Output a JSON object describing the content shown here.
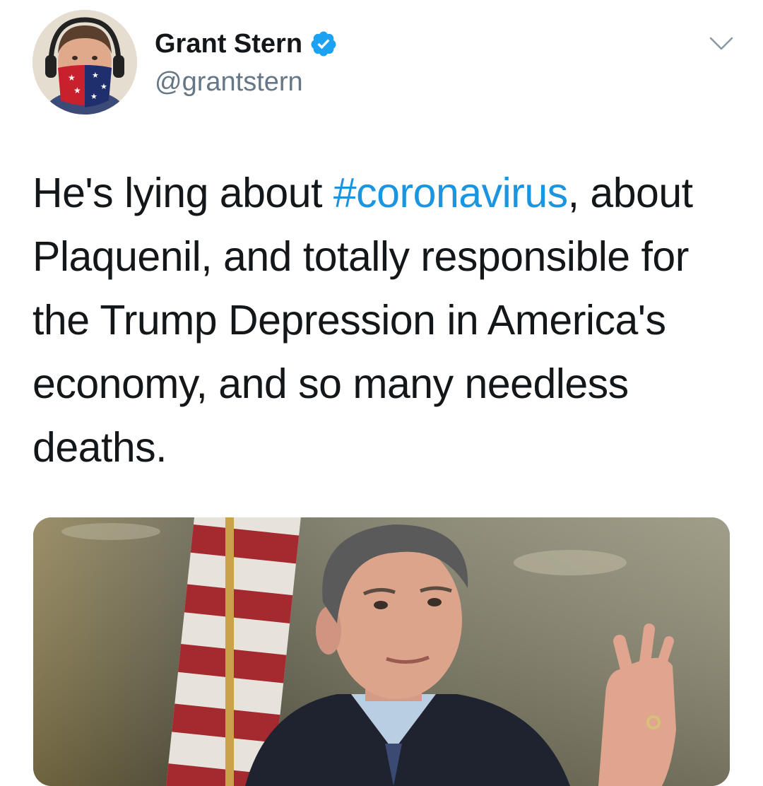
{
  "tweet": {
    "author": {
      "display_name": "Grant Stern",
      "handle": "@grantstern",
      "verified": true,
      "avatar_icon": "person-with-headphones-and-flag-mask"
    },
    "text_parts": [
      "He's lying about ",
      "#coronavirus",
      ", about Plaquenil, and totally responsible for the Trump Depression in America's economy, and so many needless deaths."
    ],
    "menu_icon": "chevron-down-icon",
    "media": {
      "type": "photo",
      "subject": "man-in-suit-with-american-flag"
    }
  },
  "colors": {
    "text": "#14171a",
    "secondary": "#657786",
    "link": "#1b95e0",
    "verified": "#1da1f2"
  }
}
